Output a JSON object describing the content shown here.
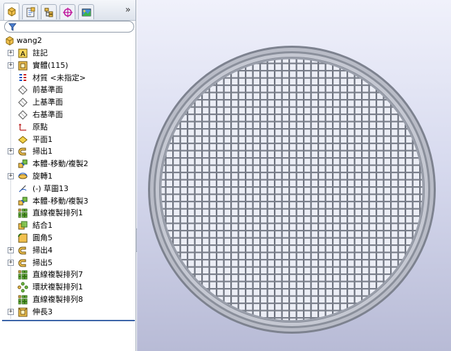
{
  "feature_tree": {
    "tabs": [
      {
        "name": "featuremanager-icon",
        "active": true
      },
      {
        "name": "propertymanager-icon",
        "active": false
      },
      {
        "name": "configurationmanager-icon",
        "active": false
      },
      {
        "name": "dimxpert-icon",
        "active": false
      },
      {
        "name": "display-manager-icon",
        "active": false
      }
    ],
    "expand_glyph": "»",
    "root": "wang2",
    "items": [
      {
        "label": "註記",
        "icon": "annotations-icon",
        "expandable": true
      },
      {
        "label": "實體(115)",
        "icon": "solid-bodies-icon",
        "expandable": true
      },
      {
        "label": "材質 <未指定>",
        "icon": "material-icon",
        "expandable": false
      },
      {
        "label": "前基準面",
        "icon": "plane-icon",
        "expandable": false
      },
      {
        "label": "上基準面",
        "icon": "plane-icon",
        "expandable": false
      },
      {
        "label": "右基準面",
        "icon": "plane-icon",
        "expandable": false
      },
      {
        "label": "原點",
        "icon": "origin-icon",
        "expandable": false
      },
      {
        "label": "平面1",
        "icon": "plane-feature-icon",
        "expandable": false
      },
      {
        "label": "掃出1",
        "icon": "sweep-icon",
        "expandable": true
      },
      {
        "label": "本體-移動/複製2",
        "icon": "move-copy-body-icon",
        "expandable": false
      },
      {
        "label": "旋轉1",
        "icon": "revolve-icon",
        "expandable": true
      },
      {
        "label": "(-) 草圖13",
        "icon": "sketch-icon",
        "expandable": false
      },
      {
        "label": "本體-移動/複製3",
        "icon": "move-copy-body-icon",
        "expandable": false
      },
      {
        "label": "直線複製排列1",
        "icon": "linear-pattern-icon",
        "expandable": false
      },
      {
        "label": "結合1",
        "icon": "combine-icon",
        "expandable": false
      },
      {
        "label": "圓角5",
        "icon": "fillet-icon",
        "expandable": false
      },
      {
        "label": "掃出4",
        "icon": "sweep-icon",
        "expandable": true
      },
      {
        "label": "掃出5",
        "icon": "sweep-icon",
        "expandable": true
      },
      {
        "label": "直線複製排列7",
        "icon": "linear-pattern-icon",
        "expandable": false
      },
      {
        "label": "環狀複製排列1",
        "icon": "circular-pattern-icon",
        "expandable": false
      },
      {
        "label": "直線複製排列8",
        "icon": "linear-pattern-icon",
        "expandable": false
      },
      {
        "label": "伸長3",
        "icon": "extrude-icon",
        "expandable": true
      }
    ]
  },
  "colors": {
    "viewport_top": "#f0f1fb",
    "viewport_bottom": "#b8bbd6",
    "ring": "#8d929e",
    "mesh": "#6f7480",
    "rollback_bar": "#3c64a8"
  }
}
